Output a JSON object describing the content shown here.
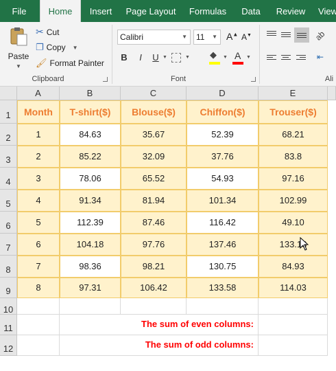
{
  "ribbon": {
    "tabs": [
      "File",
      "Home",
      "Insert",
      "Page Layout",
      "Formulas",
      "Data",
      "Review",
      "View"
    ],
    "active_tab": "Home",
    "clipboard": {
      "paste_label": "Paste",
      "cut_label": "Cut",
      "copy_label": "Copy",
      "format_painter_label": "Format Painter",
      "group_label": "Clipboard"
    },
    "font": {
      "font_name": "Calibri",
      "font_size": "11",
      "group_label": "Font",
      "bold": "B",
      "italic": "I",
      "underline": "U"
    },
    "alignment": {
      "group_label": "Ali"
    }
  },
  "sheet": {
    "columns": [
      "A",
      "B",
      "C",
      "D",
      "E"
    ],
    "rows": [
      "1",
      "2",
      "3",
      "4",
      "5",
      "6",
      "7",
      "8",
      "9",
      "10",
      "11",
      "12"
    ],
    "headers": [
      "Month",
      "T-shirt($)",
      "Blouse($)",
      "Chiffon($)",
      "Trouser($)"
    ],
    "data": [
      [
        "1",
        "84.63",
        "35.67",
        "52.39",
        "68.21"
      ],
      [
        "2",
        "85.22",
        "32.09",
        "37.76",
        "83.8"
      ],
      [
        "3",
        "78.06",
        "65.52",
        "54.93",
        "97.16"
      ],
      [
        "4",
        "91.34",
        "81.94",
        "101.34",
        "102.99"
      ],
      [
        "5",
        "112.39",
        "87.46",
        "116.42",
        "49.10"
      ],
      [
        "6",
        "104.18",
        "97.76",
        "137.46",
        "133.13"
      ],
      [
        "7",
        "98.36",
        "98.21",
        "130.75",
        "84.93"
      ],
      [
        "8",
        "97.31",
        "106.42",
        "133.58",
        "114.03"
      ]
    ],
    "sum_even_label": "The sum of even columns:",
    "sum_odd_label": "The sum of odd columns:"
  },
  "colors": {
    "ribbon_green": "#217346",
    "table_odd_fill": "#fff2cc",
    "table_even_fill": "#ffffff",
    "table_border": "#f2cc6b",
    "header_text": "#ed7d31",
    "sum_text": "#ff0000"
  }
}
